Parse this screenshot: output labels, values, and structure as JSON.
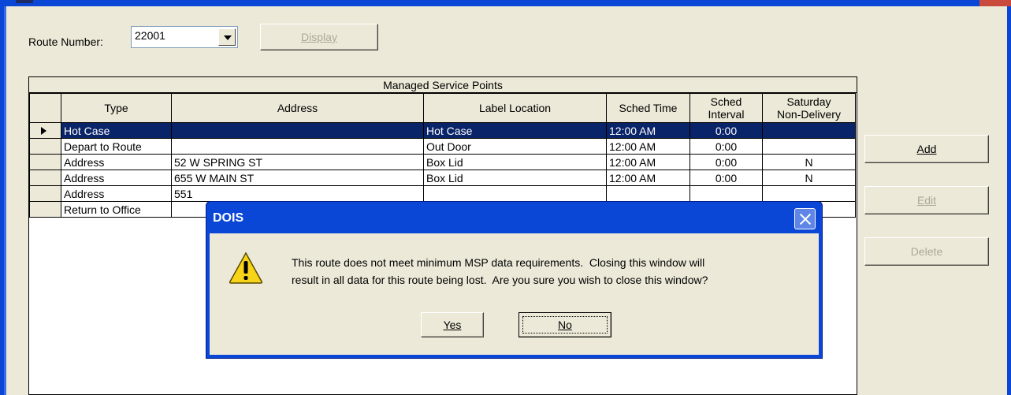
{
  "form": {
    "route_label": "Route Number:",
    "route_value": "22001",
    "display_label": "Display",
    "add_label": "Add",
    "edit_label": "Edit",
    "delete_label": "Delete"
  },
  "grid": {
    "caption": "Managed Service Points",
    "columns": [
      "Type",
      "Address",
      "Label Location",
      "Sched Time",
      "Sched\nInterval",
      "Saturday\nNon-Delivery"
    ],
    "rows": [
      {
        "type": "Hot Case",
        "address": "",
        "label": "Hot Case",
        "time": "12:00 AM",
        "interval": "0:00",
        "saturday": ""
      },
      {
        "type": "Depart to Route",
        "address": "",
        "label": "Out Door",
        "time": "12:00 AM",
        "interval": "0:00",
        "saturday": ""
      },
      {
        "type": "Address",
        "address": "52 W SPRING ST",
        "label": "Box Lid",
        "time": "12:00 AM",
        "interval": "0:00",
        "saturday": "N"
      },
      {
        "type": "Address",
        "address": "655 W MAIN ST",
        "label": "Box Lid",
        "time": "12:00 AM",
        "interval": "0:00",
        "saturday": "N"
      },
      {
        "type": "Address",
        "address": "551",
        "label": "",
        "time": "",
        "interval": "",
        "saturday": ""
      },
      {
        "type": "Return to Office",
        "address": "",
        "label": "",
        "time": "",
        "interval": "",
        "saturday": ""
      }
    ]
  },
  "dialog": {
    "title": "DOIS",
    "message_line1": "This route does not meet minimum MSP data requirements.  Closing this window will",
    "message_line2": "result in all data for this route being lost.  Are you sure you wish to close this window?",
    "yes_label": "Yes",
    "no_label": "No",
    "icon": "warning-icon"
  },
  "colors": {
    "titlebar": "#0a47d6",
    "selection": "#0a246a",
    "face": "#ece9d8"
  }
}
